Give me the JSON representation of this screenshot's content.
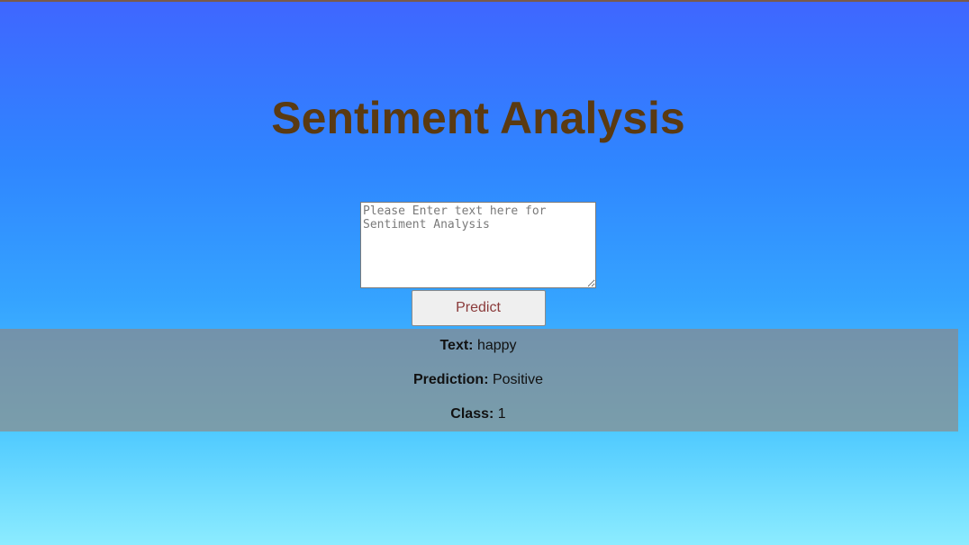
{
  "page": {
    "title": "Sentiment Analysis"
  },
  "form": {
    "input_value": "",
    "input_placeholder": "Please Enter text here for Sentiment Analysis",
    "predict_label": "Predict"
  },
  "result": {
    "text_label": "Text:",
    "text_value": "happy",
    "prediction_label": "Prediction:",
    "prediction_value": "Positive",
    "class_label": "Class:",
    "class_value": "1"
  },
  "colors": {
    "title": "#5a3a12",
    "button_text": "#8a3a3a",
    "background_top": "#3f66ff",
    "background_bottom": "#8cecff"
  }
}
